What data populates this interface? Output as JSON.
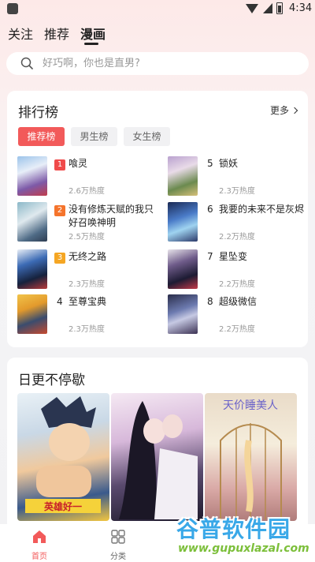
{
  "status_bar": {
    "time": "4:34"
  },
  "top_tabs": [
    {
      "label": "关注",
      "active": false
    },
    {
      "label": "推荐",
      "active": false
    },
    {
      "label": "漫画",
      "active": true
    }
  ],
  "search": {
    "placeholder": "好巧啊，你也是直男?"
  },
  "ranking": {
    "title": "排行榜",
    "more_label": "更多",
    "tabs": [
      {
        "label": "推荐榜",
        "active": true
      },
      {
        "label": "男生榜",
        "active": false
      },
      {
        "label": "女生榜",
        "active": false
      }
    ],
    "items": [
      {
        "rank": "1",
        "title": "喰灵",
        "heat": "2.6万热度",
        "badge_color": "#f04a4a"
      },
      {
        "rank": "2",
        "title": "没有修炼天赋的我只好召唤神明",
        "heat": "2.5万热度",
        "badge_color": "#f5742c"
      },
      {
        "rank": "3",
        "title": "无终之路",
        "heat": "2.3万热度",
        "badge_color": "#f5a623"
      },
      {
        "rank": "4",
        "title": "至尊宝典",
        "heat": "2.3万热度",
        "badge_color": ""
      },
      {
        "rank": "5",
        "title": "锁妖",
        "heat": "2.3万热度",
        "badge_color": ""
      },
      {
        "rank": "6",
        "title": "我要的未来不是灰烬",
        "heat": "2.2万热度",
        "badge_color": ""
      },
      {
        "rank": "7",
        "title": "星坠变",
        "heat": "2.2万热度",
        "badge_color": ""
      },
      {
        "rank": "8",
        "title": "超级微信",
        "heat": "2.2万热度",
        "badge_color": ""
      }
    ]
  },
  "daily": {
    "title": "日更不停歇",
    "covers": [
      {
        "cover_text": "英雄好一"
      },
      {
        "cover_text": ""
      },
      {
        "cover_text": "天价睡美人"
      }
    ]
  },
  "bottom_nav": [
    {
      "label": "首页",
      "icon": "home-icon",
      "active": true
    },
    {
      "label": "分类",
      "icon": "grid-icon",
      "active": false
    }
  ],
  "watermark": {
    "title": "谷普软件园",
    "url": "www.gupuxlazal.com"
  },
  "colors": {
    "accent": "#f25a5a"
  }
}
